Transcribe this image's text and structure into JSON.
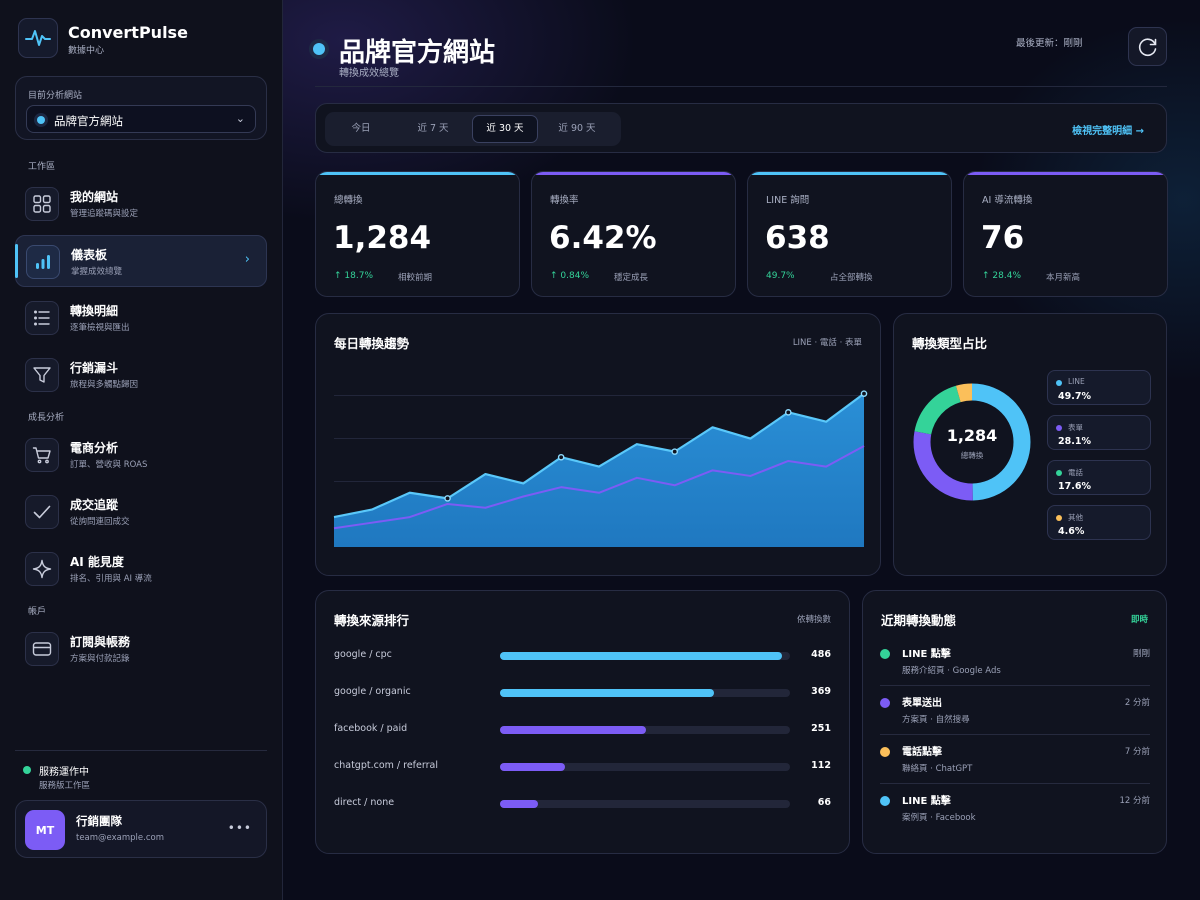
{
  "brand": {
    "name": "ConvertPulse",
    "sub": "數據中心"
  },
  "site_selector": {
    "label": "目前分析網站",
    "value": "品牌官方網站"
  },
  "sections": {
    "workspace": "工作區",
    "growth": "成長分析",
    "account": "帳戶"
  },
  "nav": [
    {
      "title": "我的網站",
      "sub": "管理追蹤碼與設定",
      "icon": "grid-icon"
    },
    {
      "title": "儀表板",
      "sub": "掌握成效總覽",
      "icon": "bar-chart-icon"
    },
    {
      "title": "轉換明細",
      "sub": "逐筆檢視與匯出",
      "icon": "list-icon"
    },
    {
      "title": "行銷漏斗",
      "sub": "旅程與多觸點歸因",
      "icon": "funnel-icon"
    },
    {
      "title": "電商分析",
      "sub": "訂單、營收與 ROAS",
      "icon": "cart-icon"
    },
    {
      "title": "成交追蹤",
      "sub": "從詢問連回成交",
      "icon": "check-icon"
    },
    {
      "title": "AI 能見度",
      "sub": "排名、引用與 AI 導流",
      "icon": "sparkle-icon"
    },
    {
      "title": "訂閱與帳務",
      "sub": "方案與付款記錄",
      "icon": "card-icon"
    }
  ],
  "status": {
    "title": "服務運作中",
    "sub": "服務版工作區"
  },
  "user": {
    "initials": "MT",
    "name": "行銷團隊",
    "email": "team@example.com",
    "more": "•••"
  },
  "header": {
    "title": "品牌官方網站",
    "sub": "轉換成效總覽",
    "last_update": "最後更新：剛剛"
  },
  "filters": {
    "ranges": [
      "今日",
      "近 7 天",
      "近 30 天",
      "近 90 天"
    ],
    "active": "近 30 天",
    "detail_link": "檢視完整明細 →"
  },
  "colors": {
    "accent": "#4fc3f7",
    "purple": "#7c5cf5",
    "green": "#34d399",
    "yellow": "#fbbf5a"
  },
  "kpis": [
    {
      "label": "總轉換",
      "value": "1,284",
      "delta": "↑ 18.7%",
      "note": "相較前期",
      "bar": "#4fc3f7"
    },
    {
      "label": "轉換率",
      "value": "6.42%",
      "delta": "↑ 0.84%",
      "note": "穩定成長",
      "bar": "#7c5cf5"
    },
    {
      "label": "LINE 詢問",
      "value": "638",
      "delta": "49.7%",
      "note": "占全部轉換",
      "bar": "#4fc3f7"
    },
    {
      "label": "AI 導流轉換",
      "value": "76",
      "delta": "↑ 28.4%",
      "note": "本月新高",
      "bar": "#7c5cf5"
    }
  ],
  "trend": {
    "title": "每日轉換趨勢",
    "channels": "LINE · 電話 · 表單"
  },
  "chart_data": [
    {
      "type": "area",
      "series": [
        {
          "values": [
            16,
            20,
            29,
            26,
            39,
            34,
            48,
            43,
            55,
            51,
            64,
            58,
            72,
            67,
            82
          ]
        },
        {
          "values": [
            10,
            13,
            16,
            23,
            21,
            27,
            32,
            29,
            37,
            33,
            41,
            38,
            46,
            43,
            54
          ]
        }
      ],
      "ylim": [
        0,
        100
      ],
      "grid": true
    },
    {
      "type": "pie",
      "title": "轉換類型占比",
      "center_value": "1,284",
      "center_label": "總轉換",
      "slices": [
        {
          "name": "LINE",
          "value": 49.7,
          "label": "49.7%",
          "color": "#4fc3f7"
        },
        {
          "name": "表單",
          "value": 28.1,
          "label": "28.1%",
          "color": "#7c5cf5"
        },
        {
          "name": "電話",
          "value": 17.6,
          "label": "17.6%",
          "color": "#34d399"
        },
        {
          "name": "其他",
          "value": 4.6,
          "label": "4.6%",
          "color": "#fbbf5a"
        }
      ]
    }
  ],
  "sources": {
    "title": "轉換來源排行",
    "sort_label": "依轉換數",
    "max": 500,
    "items": [
      {
        "name": "google / cpc",
        "value": 486,
        "label": "486",
        "color": "#4fc3f7"
      },
      {
        "name": "google / organic",
        "value": 369,
        "label": "369",
        "color": "#4fc3f7"
      },
      {
        "name": "facebook / paid",
        "value": 251,
        "label": "251",
        "color": "#7c5cf5"
      },
      {
        "name": "chatgpt.com / referral",
        "value": 112,
        "label": "112",
        "color": "#7c5cf5"
      },
      {
        "name": "direct / none",
        "value": 66,
        "label": "66",
        "color": "#7c5cf5"
      }
    ]
  },
  "activity": {
    "title": "近期轉換動態",
    "live": "即時",
    "items": [
      {
        "title": "LINE 點擊",
        "sub": "服務介紹頁 · Google Ads",
        "time": "剛剛",
        "color": "#34d399"
      },
      {
        "title": "表單送出",
        "sub": "方案頁 · 自然搜尋",
        "time": "2 分前",
        "color": "#7c5cf5"
      },
      {
        "title": "電話點擊",
        "sub": "聯絡頁 · ChatGPT",
        "time": "7 分前",
        "color": "#fbbf5a"
      },
      {
        "title": "LINE 點擊",
        "sub": "案例頁 · Facebook",
        "time": "12 分前",
        "color": "#4fc3f7"
      }
    ]
  }
}
